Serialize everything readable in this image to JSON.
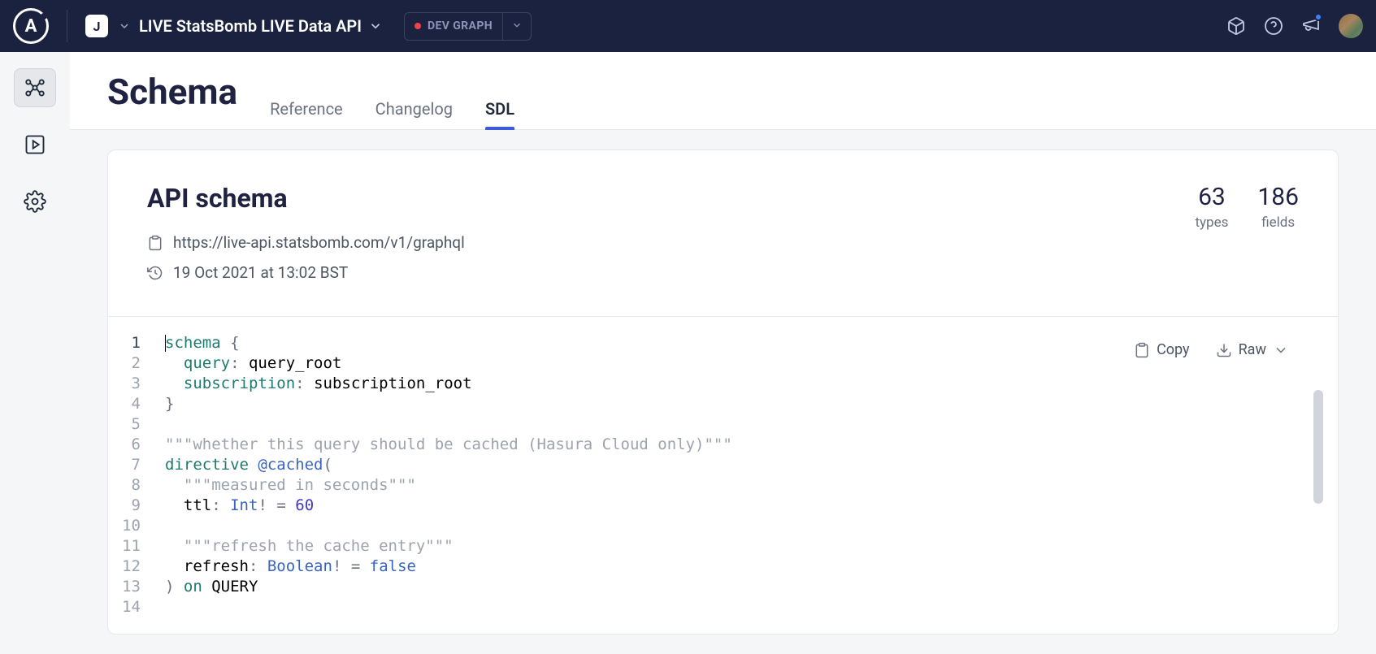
{
  "topnav": {
    "org_initial": "J",
    "graph_name": "LIVE StatsBomb LIVE Data API",
    "env_label": "DEV GRAPH"
  },
  "page": {
    "title": "Schema",
    "tabs": [
      {
        "label": "Reference",
        "active": false
      },
      {
        "label": "Changelog",
        "active": false
      },
      {
        "label": "SDL",
        "active": true
      }
    ]
  },
  "schema_card": {
    "title": "API schema",
    "endpoint": "https://live-api.statsbomb.com/v1/graphql",
    "timestamp": "19 Oct 2021 at 13:02 BST",
    "stats": {
      "types": {
        "count": "63",
        "label": "types"
      },
      "fields": {
        "count": "186",
        "label": "fields"
      }
    },
    "actions": {
      "copy": "Copy",
      "raw": "Raw"
    }
  },
  "code": {
    "line_numbers": [
      "1",
      "2",
      "3",
      "4",
      "5",
      "6",
      "7",
      "8",
      "9",
      "10",
      "11",
      "12",
      "13",
      "14"
    ],
    "lines": [
      {
        "t": [
          {
            "c": "tok-kw",
            "v": "schema"
          },
          {
            "c": "",
            "v": " "
          },
          {
            "c": "tok-punct",
            "v": "{"
          }
        ]
      },
      {
        "t": [
          {
            "c": "",
            "v": "  "
          },
          {
            "c": "tok-kw",
            "v": "query"
          },
          {
            "c": "tok-punct",
            "v": ":"
          },
          {
            "c": "",
            "v": " query_root"
          }
        ]
      },
      {
        "t": [
          {
            "c": "",
            "v": "  "
          },
          {
            "c": "tok-kw",
            "v": "subscription"
          },
          {
            "c": "tok-punct",
            "v": ":"
          },
          {
            "c": "",
            "v": " subscription_root"
          }
        ]
      },
      {
        "t": [
          {
            "c": "tok-punct",
            "v": "}"
          }
        ]
      },
      {
        "t": [
          {
            "c": "",
            "v": ""
          }
        ]
      },
      {
        "t": [
          {
            "c": "tok-str",
            "v": "\"\"\"whether this query should be cached (Hasura Cloud only)\"\"\""
          }
        ]
      },
      {
        "t": [
          {
            "c": "tok-kw",
            "v": "directive"
          },
          {
            "c": "",
            "v": " "
          },
          {
            "c": "tok-type",
            "v": "@cached"
          },
          {
            "c": "tok-punct",
            "v": "("
          }
        ]
      },
      {
        "t": [
          {
            "c": "",
            "v": "  "
          },
          {
            "c": "tok-str",
            "v": "\"\"\"measured in seconds\"\"\""
          }
        ]
      },
      {
        "t": [
          {
            "c": "",
            "v": "  ttl"
          },
          {
            "c": "tok-punct",
            "v": ":"
          },
          {
            "c": "",
            "v": " "
          },
          {
            "c": "tok-type",
            "v": "Int"
          },
          {
            "c": "tok-punct",
            "v": "!"
          },
          {
            "c": "",
            "v": " "
          },
          {
            "c": "tok-punct",
            "v": "="
          },
          {
            "c": "",
            "v": " "
          },
          {
            "c": "tok-num",
            "v": "60"
          }
        ]
      },
      {
        "t": [
          {
            "c": "",
            "v": ""
          }
        ]
      },
      {
        "t": [
          {
            "c": "",
            "v": "  "
          },
          {
            "c": "tok-str",
            "v": "\"\"\"refresh the cache entry\"\"\""
          }
        ]
      },
      {
        "t": [
          {
            "c": "",
            "v": "  refresh"
          },
          {
            "c": "tok-punct",
            "v": ":"
          },
          {
            "c": "",
            "v": " "
          },
          {
            "c": "tok-type",
            "v": "Boolean"
          },
          {
            "c": "tok-punct",
            "v": "!"
          },
          {
            "c": "",
            "v": " "
          },
          {
            "c": "tok-punct",
            "v": "="
          },
          {
            "c": "",
            "v": " "
          },
          {
            "c": "tok-bool",
            "v": "false"
          }
        ]
      },
      {
        "t": [
          {
            "c": "tok-punct",
            "v": ")"
          },
          {
            "c": "",
            "v": " "
          },
          {
            "c": "tok-kw",
            "v": "on"
          },
          {
            "c": "",
            "v": " QUERY"
          }
        ]
      },
      {
        "t": [
          {
            "c": "",
            "v": ""
          }
        ]
      }
    ]
  }
}
